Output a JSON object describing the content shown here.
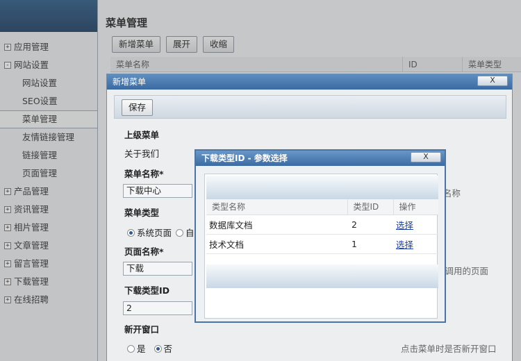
{
  "sidebar": {
    "items": [
      {
        "expand": "+",
        "label": "应用管理",
        "level": 1
      },
      {
        "expand": "-",
        "label": "网站设置",
        "level": 1
      },
      {
        "expand": "",
        "label": "网站设置",
        "level": 2
      },
      {
        "expand": "",
        "label": "SEO设置",
        "level": 2
      },
      {
        "expand": "",
        "label": "菜单管理",
        "level": 2,
        "active": true
      },
      {
        "expand": "",
        "label": "友情链接管理",
        "level": 2
      },
      {
        "expand": "",
        "label": "链接管理",
        "level": 2
      },
      {
        "expand": "",
        "label": "页面管理",
        "level": 2
      },
      {
        "expand": "+",
        "label": "产品管理",
        "level": 1
      },
      {
        "expand": "+",
        "label": "资讯管理",
        "level": 1
      },
      {
        "expand": "+",
        "label": "相片管理",
        "level": 1
      },
      {
        "expand": "+",
        "label": "文章管理",
        "level": 1
      },
      {
        "expand": "+",
        "label": "留言管理",
        "level": 1
      },
      {
        "expand": "+",
        "label": "下载管理",
        "level": 1
      },
      {
        "expand": "+",
        "label": "在线招聘",
        "level": 1
      }
    ]
  },
  "main": {
    "title": "菜单管理",
    "toolbar": {
      "add": "新增菜单",
      "expand": "展开",
      "collapse": "收缩"
    },
    "grid_columns": [
      "菜单名称",
      "ID",
      "菜单类型"
    ]
  },
  "modal_add": {
    "title": "新增菜单",
    "close": "X",
    "save": "保存",
    "parent_label": "上级菜单",
    "parent_value": "关于我们",
    "name_label": "菜单名称*",
    "name_value": "下载中心",
    "name_hint": "名称",
    "type_label": "菜单类型",
    "type_option_system": "系统页面",
    "type_option_custom": "自",
    "page_label": "页面名称*",
    "page_value": "下载",
    "page_hint": "所调用的页面",
    "download_type_label": "下载类型ID",
    "download_type_value": "2",
    "new_window_label": "新开窗口",
    "new_window_yes": "是",
    "new_window_no": "否",
    "new_window_hint": "点击菜单时是否新开窗口"
  },
  "modal_select": {
    "title": "下载类型ID - 参数选择",
    "close": "X",
    "columns": [
      "类型名称",
      "类型ID",
      "操作"
    ],
    "rows": [
      {
        "name": "数据库文档",
        "id": "2",
        "action": "选择"
      },
      {
        "name": "技术文档",
        "id": "1",
        "action": "选择"
      }
    ]
  }
}
